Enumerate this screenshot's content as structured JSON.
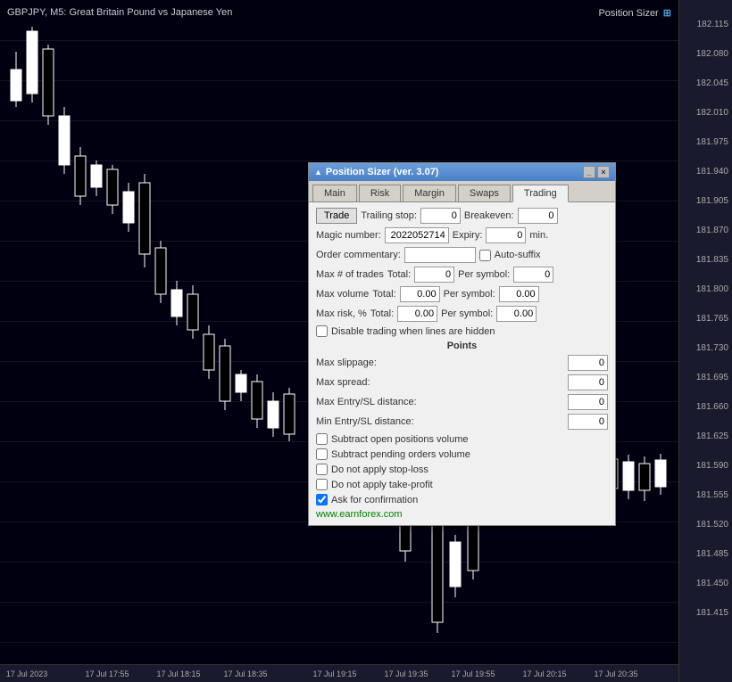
{
  "chart": {
    "title": "GBPJPY, M5: Great Britain Pound vs Japanese Yen",
    "position_sizer_label": "Position Sizer",
    "price_labels": [
      "182.115",
      "182.080",
      "182.045",
      "182.010",
      "181.975",
      "181.940",
      "181.905",
      "181.870",
      "181.835",
      "181.800",
      "181.765",
      "181.730",
      "181.695",
      "181.660",
      "181.625",
      "181.590",
      "181.555",
      "181.520",
      "181.485",
      "181.450",
      "181.415"
    ],
    "time_labels": [
      "17 Jul 2023",
      "17 Jul 17:55",
      "17 Jul 18:15",
      "17 Jul 18:35",
      "17 Jul 19:15",
      "17 Jul 19:35",
      "17 Jul 19:55",
      "17 Jul 20:15",
      "17 Jul 20:35"
    ]
  },
  "dialog": {
    "title": "Position Sizer (ver. 3.07)",
    "minimize_label": "_",
    "close_label": "×",
    "tabs": [
      {
        "id": "main",
        "label": "Main"
      },
      {
        "id": "risk",
        "label": "Risk"
      },
      {
        "id": "margin",
        "label": "Margin"
      },
      {
        "id": "swaps",
        "label": "Swaps"
      },
      {
        "id": "trading",
        "label": "Trading"
      }
    ],
    "active_tab": "trading",
    "trade_button": "Trade",
    "trailing_stop_label": "Trailing stop:",
    "trailing_stop_value": "0",
    "breakeven_label": "Breakeven:",
    "breakeven_value": "0",
    "magic_number_label": "Magic number:",
    "magic_number_value": "2022052714",
    "expiry_label": "Expiry:",
    "expiry_value": "0",
    "expiry_unit": "min.",
    "order_commentary_label": "Order commentary:",
    "order_commentary_value": "",
    "auto_suffix_label": "Auto-suffix",
    "auto_suffix_checked": false,
    "max_trades_label": "Max # of trades",
    "max_trades_total_label": "Total:",
    "max_trades_total_value": "0",
    "max_trades_per_symbol_label": "Per symbol:",
    "max_trades_per_symbol_value": "0",
    "max_volume_label": "Max volume",
    "max_volume_total_label": "Total:",
    "max_volume_total_value": "0.00",
    "max_volume_per_symbol_label": "Per symbol:",
    "max_volume_per_symbol_value": "0.00",
    "max_risk_label": "Max risk, %",
    "max_risk_total_label": "Total:",
    "max_risk_total_value": "0.00",
    "max_risk_per_symbol_label": "Per symbol:",
    "max_risk_per_symbol_value": "0.00",
    "disable_trading_label": "Disable trading when lines are hidden",
    "disable_trading_checked": false,
    "points_header": "Points",
    "max_slippage_label": "Max slippage:",
    "max_slippage_value": "0",
    "max_spread_label": "Max spread:",
    "max_spread_value": "0",
    "max_entry_sl_label": "Max Entry/SL distance:",
    "max_entry_sl_value": "0",
    "min_entry_sl_label": "Min Entry/SL distance:",
    "min_entry_sl_value": "0",
    "subtract_open_label": "Subtract open positions volume",
    "subtract_open_checked": false,
    "subtract_pending_label": "Subtract pending orders volume",
    "subtract_pending_checked": false,
    "do_not_apply_sl_label": "Do not apply stop-loss",
    "do_not_apply_sl_checked": false,
    "do_not_apply_tp_label": "Do not apply take-profit",
    "do_not_apply_tp_checked": false,
    "ask_confirmation_label": "Ask for confirmation",
    "ask_confirmation_checked": true,
    "website_label": "www.earnforex.com"
  }
}
